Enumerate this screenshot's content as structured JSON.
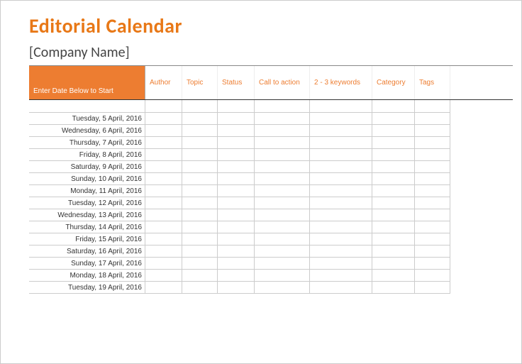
{
  "title": "Editorial Calendar",
  "company": "[Company Name]",
  "header": {
    "date_instruction": "Enter Date Below to Start",
    "columns": {
      "author": "Author",
      "topic": "Topic",
      "status": "Status",
      "call_to_action": "Call to action",
      "keywords": "2 - 3 keywords",
      "category": "Category",
      "tags": "Tags"
    }
  },
  "rows": [
    {
      "date": "Tuesday, 5 April, 2016"
    },
    {
      "date": "Wednesday, 6 April, 2016"
    },
    {
      "date": "Thursday, 7 April, 2016"
    },
    {
      "date": "Friday, 8 April, 2016"
    },
    {
      "date": "Saturday, 9 April, 2016"
    },
    {
      "date": "Sunday, 10 April, 2016"
    },
    {
      "date": "Monday, 11 April, 2016"
    },
    {
      "date": "Tuesday, 12 April, 2016"
    },
    {
      "date": "Wednesday, 13 April, 2016"
    },
    {
      "date": "Thursday, 14 April, 2016"
    },
    {
      "date": "Friday, 15 April, 2016"
    },
    {
      "date": "Saturday, 16 April, 2016"
    },
    {
      "date": "Sunday, 17 April, 2016"
    },
    {
      "date": "Monday, 18 April, 2016"
    },
    {
      "date": "Tuesday, 19 April, 2016"
    }
  ]
}
